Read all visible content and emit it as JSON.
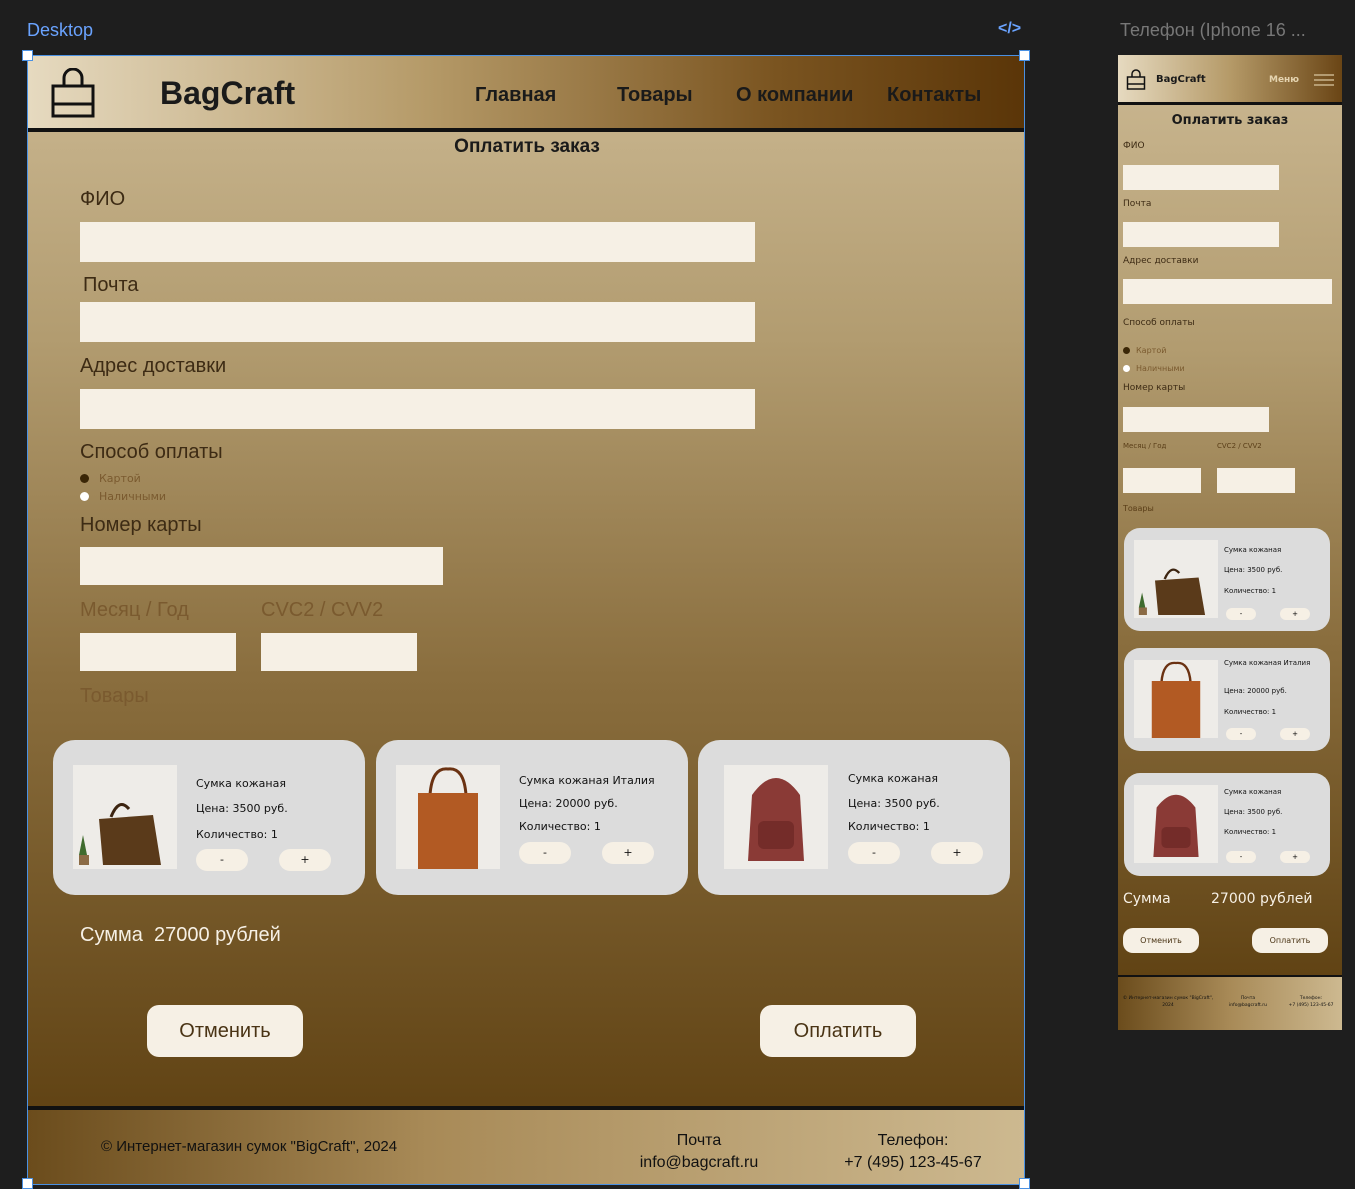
{
  "canvas": {
    "desktop_label": "Desktop",
    "code_icon": "</>",
    "phone_label": "Телефон (Iphone 16 ..."
  },
  "header": {
    "brand": "BagCraft",
    "nav": [
      "Главная",
      "Товары",
      "О компании",
      "Контакты"
    ],
    "menu_label": "Меню"
  },
  "form": {
    "title": "Оплатить заказ",
    "fio_label": "ФИО",
    "email_label": "Почта",
    "address_label": "Адрес доставки",
    "payment_label": "Способ оплаты",
    "payment_options": [
      "Картой",
      "Наличными"
    ],
    "card_number_label": "Номер карты",
    "month_year_label": "Месяц / Год",
    "cvc_label": "CVC2 / CVV2",
    "goods_label": "Товары",
    "phone_month_year_label": "Месяц / Год",
    "phone_cvc_label": "CVC2 / CVV2"
  },
  "products": [
    {
      "name": "Сумка кожаная",
      "price": "Цена: 3500 руб.",
      "qty": "Количество: 1"
    },
    {
      "name": "Сумка кожаная Италия",
      "price": "Цена: 20000 руб.",
      "qty": "Количество: 1"
    },
    {
      "name": "Сумка кожаная",
      "price": "Цена: 3500 руб.",
      "qty": "Количество: 1"
    }
  ],
  "qty_buttons": {
    "minus": "-",
    "plus": "+"
  },
  "summary": {
    "label": "Сумма",
    "value": "27000 рублей"
  },
  "actions": {
    "cancel": "Отменить",
    "pay": "Оплатить"
  },
  "footer": {
    "copyright": "© Интернет-магазин сумок \"BigCraft\", 2024",
    "email_title": "Почта",
    "email": "info@bagcraft.ru",
    "phone_title": "Телефон:",
    "phone": "+7 (495) 123-45-67"
  },
  "phone_footer": {
    "copyright": "© Интернет-магазин сумок \"BigCraft\", 2024",
    "email_title": "Почта",
    "email": "info@bagcraft.ru",
    "phone_title": "Телефон:",
    "phone": "+7 (495) 123-45-67"
  },
  "colors": {
    "accent_blue": "#4a90e2",
    "input_bg": "#f6f0e5",
    "card_bg": "#dcdcdc",
    "dark_brown": "#3a2606"
  },
  "icons": {
    "logo": "shopping-bag-icon",
    "menu": "hamburger-menu-icon"
  }
}
